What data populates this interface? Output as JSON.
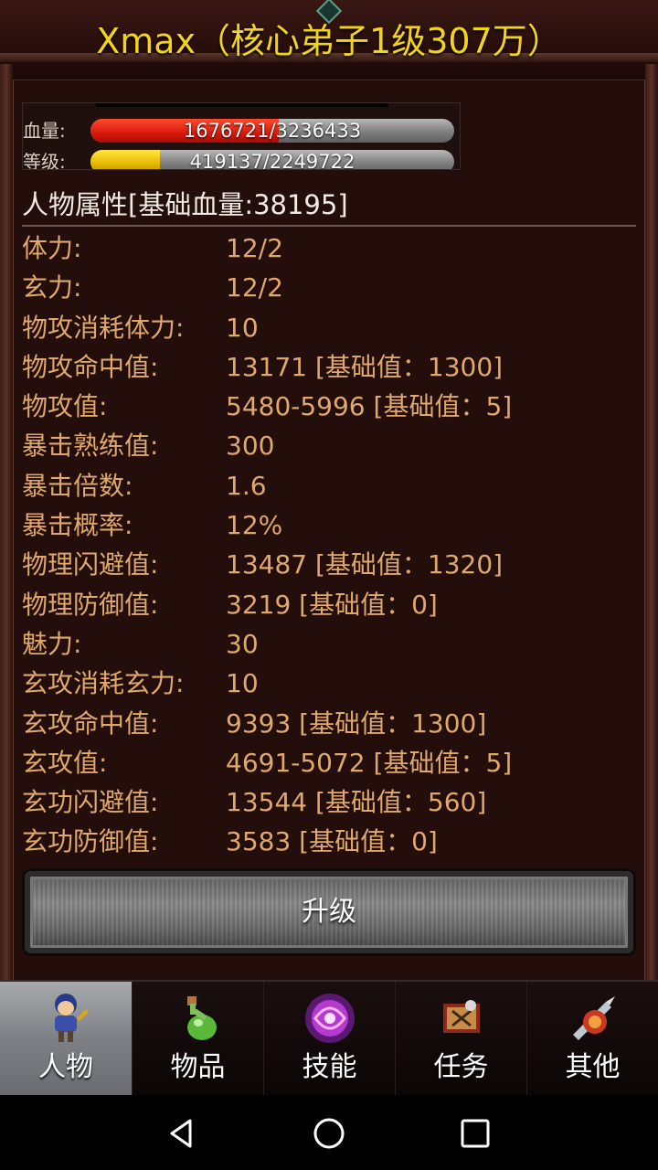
{
  "header": {
    "title": "Xmax（核心弟子1级307万）"
  },
  "status": {
    "hp": {
      "label": "血量:",
      "text": "1676721/3236433",
      "current": 1676721,
      "max": 3236433,
      "fill_fraction": 0.518
    },
    "exp": {
      "label": "等级:",
      "text": "419137/2249722",
      "fill_fraction": 0.19
    }
  },
  "attributes": {
    "header": "人物属性[基础血量:38195]",
    "rows": [
      {
        "label": "体力:",
        "value": "12/2"
      },
      {
        "label": "玄力:",
        "value": "12/2"
      },
      {
        "label": "物攻消耗体力:",
        "value": "10"
      },
      {
        "label": "物攻命中值:",
        "value": "13171 [基础值：1300]"
      },
      {
        "label": "物攻值:",
        "value": "5480-5996 [基础值：5]"
      },
      {
        "label": "暴击熟练值:",
        "value": "300"
      },
      {
        "label": "暴击倍数:",
        "value": "1.6"
      },
      {
        "label": "暴击概率:",
        "value": "12%"
      },
      {
        "label": "物理闪避值:",
        "value": "13487 [基础值：1320]"
      },
      {
        "label": "物理防御值:",
        "value": "3219 [基础值：0]"
      },
      {
        "label": "魅力:",
        "value": "30"
      },
      {
        "label": "玄攻消耗玄力:",
        "value": "10"
      },
      {
        "label": "玄攻命中值:",
        "value": "9393 [基础值：1300]"
      },
      {
        "label": "玄攻值:",
        "value": "4691-5072 [基础值：5]"
      },
      {
        "label": "玄功闪避值:",
        "value": "13544 [基础值：560]"
      },
      {
        "label": "玄功防御值:",
        "value": "3583 [基础值：0]"
      }
    ]
  },
  "upgrade_button": {
    "label": "升级"
  },
  "tabs": [
    {
      "label": "人物",
      "icon": "character-icon",
      "active": true
    },
    {
      "label": "物品",
      "icon": "potion-icon",
      "active": false
    },
    {
      "label": "技能",
      "icon": "skill-orb-icon",
      "active": false
    },
    {
      "label": "任务",
      "icon": "quest-icon",
      "active": false
    },
    {
      "label": "其他",
      "icon": "misc-icon",
      "active": false
    }
  ],
  "android_nav": {
    "back": "back-icon",
    "home": "home-icon",
    "recents": "recents-icon"
  },
  "colors": {
    "title": "#f2d41a",
    "attribute_text": "#e0a86a",
    "hp_fill": "#d81a0c",
    "exp_fill": "#e6b800",
    "panel_bg": "#230e0c"
  }
}
